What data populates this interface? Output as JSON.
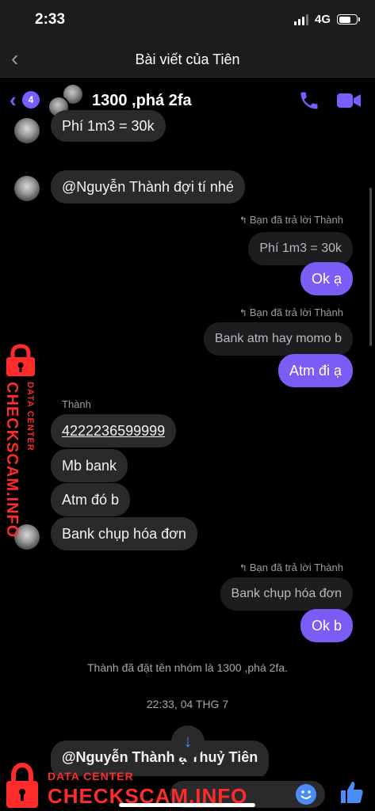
{
  "status_bar": {
    "time": "2:33",
    "network": "4G"
  },
  "outer_nav": {
    "title": "Bài viết của Tiên"
  },
  "chat_header": {
    "unread_count": "4",
    "title": "1300 ,phá 2fa"
  },
  "messages": {
    "m1": "Phí 1m3 = 30k",
    "m2": "@Nguyễn Thành đợi tí nhé",
    "reply1_label": "Bạn đã trả lời Thành",
    "reply1_quoted": "Phí 1m3 = 30k",
    "reply1_text": "Ok ạ",
    "reply2_label": "Bạn đã trả lời Thành",
    "reply2_quoted": "Bank atm hay momo b",
    "reply2_text": "Atm đi ạ",
    "sender": "Thành",
    "m3": "4222236599999",
    "m4": "Mb bank",
    "m5": "Atm đó b",
    "m6": "Bank chụp hóa đơn",
    "reply3_label": "Bạn đã trả lời Thành",
    "reply3_quoted": "Bank chụp hóa đơn",
    "reply3_text": "Ok b",
    "system": "Thành đã đặt tên nhóm là 1300 ,phá 2fa.",
    "timestamp": "22:33, 04 THG 7",
    "last_partial": "@Nguyễn Thành ạ Thuỷ Tiên"
  },
  "watermark": {
    "small": "DATA CENTER",
    "big": "CHECKSCAM.INFO"
  },
  "colors": {
    "accent": "#7b5cf5",
    "watermark": "#ff2b2b",
    "blue": "#4a8df8"
  }
}
